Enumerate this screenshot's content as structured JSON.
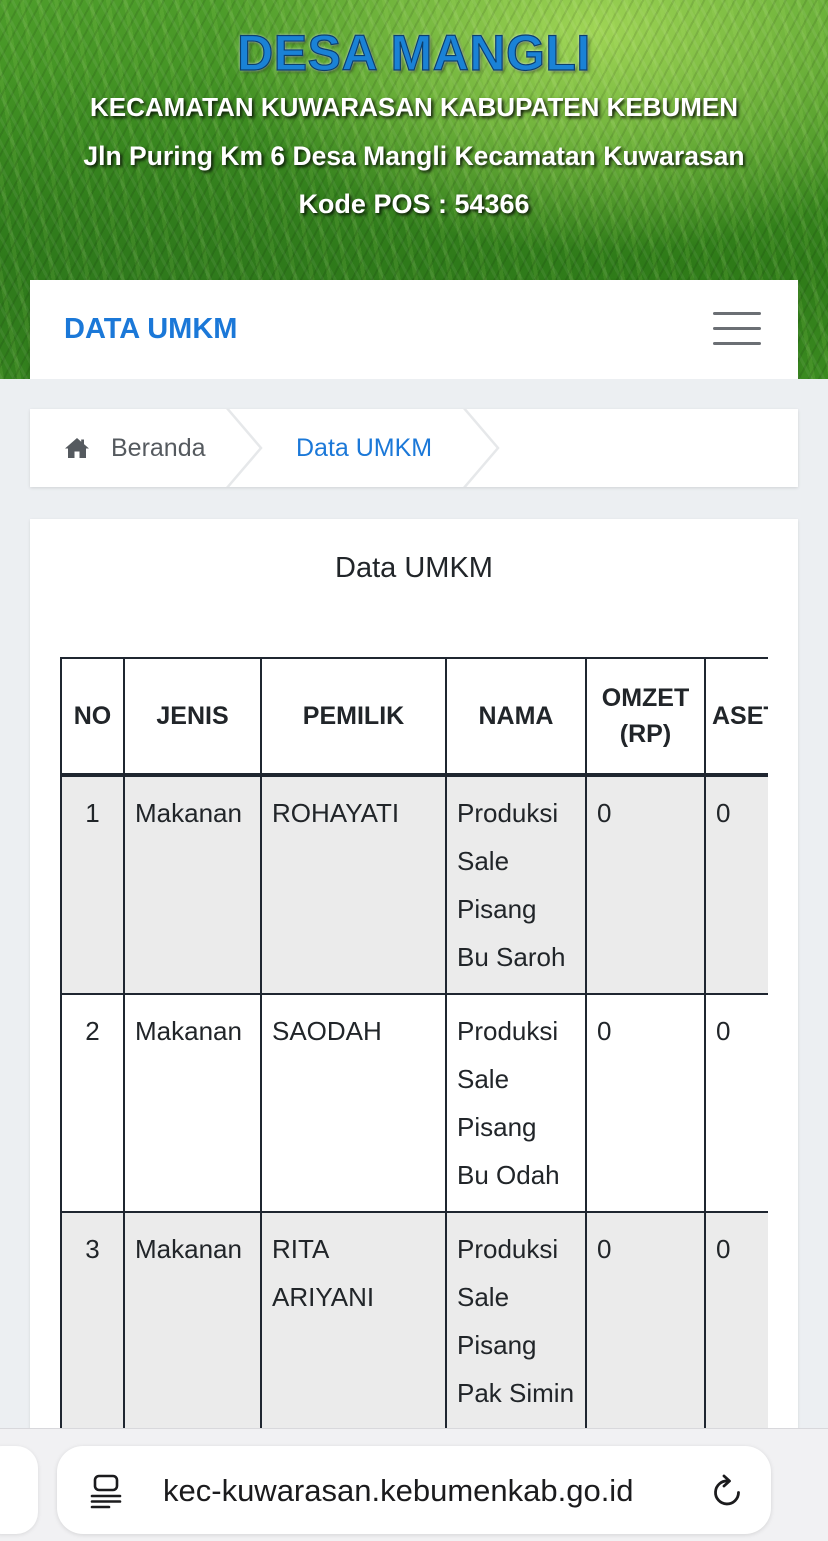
{
  "header": {
    "title": "DESA MANGLI",
    "line1": "KECAMATAN KUWARASAN KABUPATEN KEBUMEN",
    "line2": "Jln Puring Km 6 Desa Mangli Kecamatan Kuwarasan",
    "line3": "Kode POS : 54366"
  },
  "navbar": {
    "brand": "DATA UMKM",
    "menu_icon": "hamburger-menu-icon"
  },
  "breadcrumb": {
    "home_icon": "home-icon",
    "home_label": "Beranda",
    "current_label": "Data UMKM"
  },
  "content": {
    "title": "Data UMKM",
    "table": {
      "headers": {
        "no": "NO",
        "jenis": "JENIS",
        "pemilik": "PEMILIK",
        "nama": "NAMA",
        "omzet": "OMZET (RP)",
        "aset": "ASET (RP)"
      },
      "rows": [
        {
          "no": "1",
          "jenis": "Makanan",
          "pemilik": "ROHAYATI",
          "nama": "Produksi Sale Pisang Bu Saroh",
          "omzet": "0",
          "aset": "0"
        },
        {
          "no": "2",
          "jenis": "Makanan",
          "pemilik": "SAODAH",
          "nama": "Produksi Sale Pisang Bu Odah",
          "omzet": "0",
          "aset": "0"
        },
        {
          "no": "3",
          "jenis": "Makanan",
          "pemilik": "RITA ARIYANI",
          "nama": "Produksi Sale Pisang Pak Simin",
          "omzet": "0",
          "aset": "0"
        }
      ]
    }
  },
  "browser": {
    "url": "kec-kuwarasan.kebumenkab.go.id",
    "reader_icon": "reader-mode-icon",
    "reload_icon": "reload-icon"
  },
  "colors": {
    "accent": "#1b78d8",
    "title_blue": "#1a82d6",
    "header_green": "#3f8f22",
    "table_border": "#1f2630",
    "row_shade": "#ebebeb"
  }
}
